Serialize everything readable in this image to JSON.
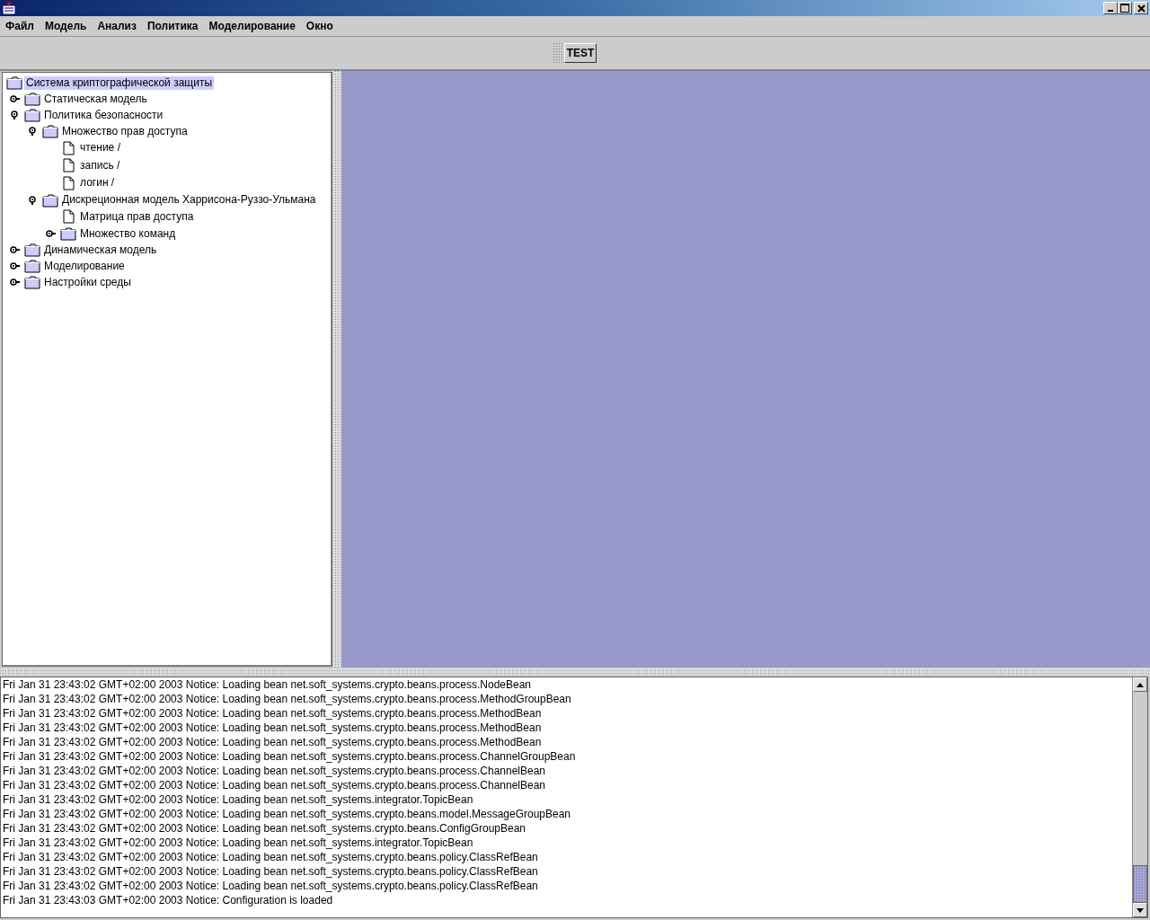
{
  "menu": [
    {
      "label": "Файл"
    },
    {
      "label": "Модель"
    },
    {
      "label": "Анализ"
    },
    {
      "label": "Политика"
    },
    {
      "label": "Моделирование"
    },
    {
      "label": "Окно"
    }
  ],
  "toolbar": {
    "buttons": [
      {
        "label": "TEST"
      }
    ]
  },
  "tree": {
    "root": {
      "label": "Система криптографической защиты",
      "kind": "folder",
      "selected": true,
      "children": [
        {
          "label": "Статическая модель",
          "kind": "folder",
          "expanded": false,
          "selected": false
        },
        {
          "label": "Политика безопасности",
          "kind": "folder",
          "expanded": true,
          "selected": false,
          "children": [
            {
              "label": "Множество прав доступа",
              "kind": "folder",
              "expanded": true,
              "selected": false,
              "children": [
                {
                  "label": "чтение /",
                  "kind": "document",
                  "selected": false
                },
                {
                  "label": "запись /",
                  "kind": "document",
                  "selected": false
                },
                {
                  "label": "логин /",
                  "kind": "document",
                  "selected": false
                }
              ]
            },
            {
              "label": "Дискреционная модель Харрисона-Руззо-Ульмана",
              "kind": "folder",
              "expanded": true,
              "selected": false,
              "children": [
                {
                  "label": "Матрица прав доступа",
                  "kind": "document",
                  "selected": false
                },
                {
                  "label": "Множество команд",
                  "kind": "folder",
                  "expanded": false,
                  "selected": false
                }
              ]
            }
          ]
        },
        {
          "label": "Динамическая модель",
          "kind": "folder",
          "expanded": false,
          "selected": false
        },
        {
          "label": "Моделирование",
          "kind": "folder",
          "expanded": false,
          "selected": false
        },
        {
          "label": "Настройки среды",
          "kind": "folder",
          "expanded": false,
          "selected": false
        }
      ]
    }
  },
  "log": {
    "lines": [
      "Fri Jan 31 23:43:02 GMT+02:00 2003 Notice: Loading bean net.soft_systems.crypto.beans.process.NodeBean",
      "Fri Jan 31 23:43:02 GMT+02:00 2003 Notice: Loading bean net.soft_systems.crypto.beans.process.MethodGroupBean",
      "Fri Jan 31 23:43:02 GMT+02:00 2003 Notice: Loading bean net.soft_systems.crypto.beans.process.MethodBean",
      "Fri Jan 31 23:43:02 GMT+02:00 2003 Notice: Loading bean net.soft_systems.crypto.beans.process.MethodBean",
      "Fri Jan 31 23:43:02 GMT+02:00 2003 Notice: Loading bean net.soft_systems.crypto.beans.process.MethodBean",
      "Fri Jan 31 23:43:02 GMT+02:00 2003 Notice: Loading bean net.soft_systems.crypto.beans.process.ChannelGroupBean",
      "Fri Jan 31 23:43:02 GMT+02:00 2003 Notice: Loading bean net.soft_systems.crypto.beans.process.ChannelBean",
      "Fri Jan 31 23:43:02 GMT+02:00 2003 Notice: Loading bean net.soft_systems.crypto.beans.process.ChannelBean",
      "Fri Jan 31 23:43:02 GMT+02:00 2003 Notice: Loading bean net.soft_systems.integrator.TopicBean",
      "Fri Jan 31 23:43:02 GMT+02:00 2003 Notice: Loading bean net.soft_systems.crypto.beans.model.MessageGroupBean",
      "Fri Jan 31 23:43:02 GMT+02:00 2003 Notice: Loading bean net.soft_systems.crypto.beans.ConfigGroupBean",
      "Fri Jan 31 23:43:02 GMT+02:00 2003 Notice: Loading bean net.soft_systems.integrator.TopicBean",
      "Fri Jan 31 23:43:02 GMT+02:00 2003 Notice: Loading bean net.soft_systems.crypto.beans.policy.ClassRefBean",
      "Fri Jan 31 23:43:02 GMT+02:00 2003 Notice: Loading bean net.soft_systems.crypto.beans.policy.ClassRefBean",
      "Fri Jan 31 23:43:02 GMT+02:00 2003 Notice: Loading bean net.soft_systems.crypto.beans.policy.ClassRefBean",
      "Fri Jan 31 23:43:03 GMT+02:00 2003 Notice: Configuration is loaded"
    ]
  }
}
